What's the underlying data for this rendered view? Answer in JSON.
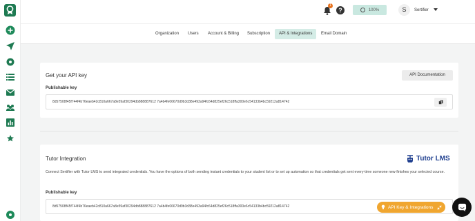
{
  "topbar": {
    "notification_count": "1",
    "help_glyph": "?",
    "credits": "100%",
    "avatar_initial": "S",
    "username": "Sertifier"
  },
  "tabs": [
    {
      "label": "Organization",
      "active": false
    },
    {
      "label": "Users",
      "active": false
    },
    {
      "label": "Account & Billing",
      "active": false
    },
    {
      "label": "Subscription",
      "active": false
    },
    {
      "label": "API & Integrations",
      "active": true
    },
    {
      "label": "Email Domain",
      "active": false
    }
  ],
  "api_card": {
    "title": "Get your API key",
    "doc_button": "API Documentation",
    "key_label": "Publishable key",
    "key_value": "8d57508f45f744f4b76eaeb42c810a667a8e59af30294db888887612 7a4b4fe06670d9b3d38e493a94fc64d825ef26c518ffa300e6c54133b4bc59212a814742"
  },
  "tutor_card": {
    "title": "Tutor Integration",
    "logo_text": "Tutor LMS",
    "description": "Connect Sertifier with Tutor LMS to send integrated credentials. You have the options of both sending instant credentials to your student list or to set up automation so that credentials get sent every-time someone new finishes your selected course.",
    "key_label": "Publishable key",
    "key_value": "8d57508f45f744f4b76eaeb42c810a667a8e59af30294db888887612 7a4b4fe06670d9b3d38e493a94fc64d825ef26c518ffa300e6c54133b4bc59212a814742"
  },
  "floating": {
    "pill_label": "API Key & Integrations"
  },
  "colors": {
    "brand": "#1e8a5a",
    "active_tab": "#d4ece6",
    "credits_bg": "#c9e8e0",
    "pill": "#f0a630",
    "tutor_blue": "#1f3f8f"
  }
}
